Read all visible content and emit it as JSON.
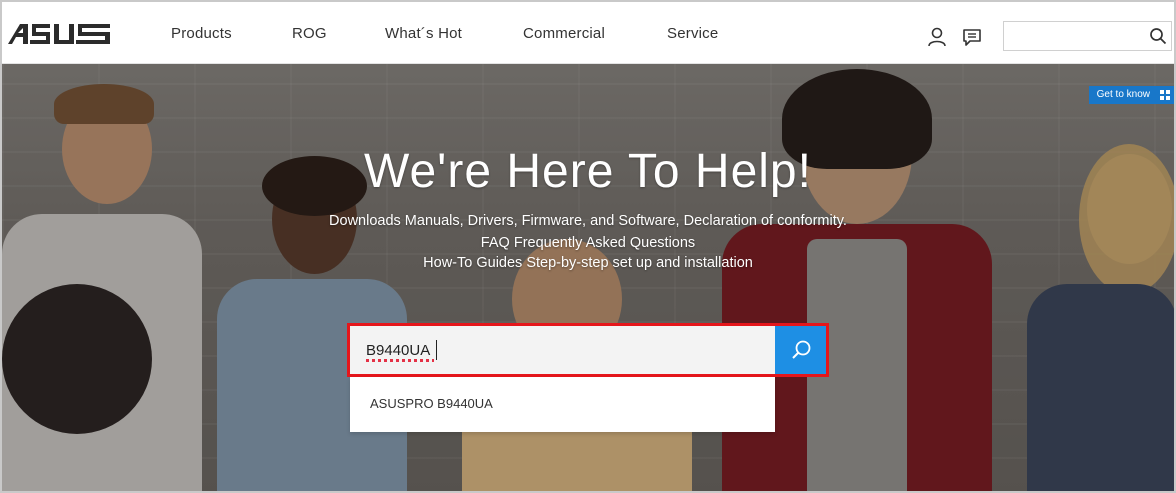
{
  "nav": {
    "brand": "ASUS",
    "items": [
      {
        "label": "Products"
      },
      {
        "label": "ROG"
      },
      {
        "label": "What´s Hot"
      },
      {
        "label": "Commercial"
      },
      {
        "label": "Service"
      }
    ],
    "icons": [
      "user-icon",
      "chat-icon",
      "search-icon"
    ],
    "search_value": ""
  },
  "hero": {
    "badge": "Get to know",
    "title": "We're Here To Help!",
    "lines": [
      "Downloads Manuals, Drivers, Firmware, and Software, Declaration of conformity.",
      "FAQ Frequently Asked Questions",
      "How-To Guides Step-by-step set up and installation"
    ],
    "search": {
      "value": "B9440UA",
      "button_icon": "search-icon",
      "highlight_color": "#e5161b",
      "button_color": "#1e8fe4"
    },
    "suggestions": [
      "ASUSPRO B9440UA"
    ]
  }
}
